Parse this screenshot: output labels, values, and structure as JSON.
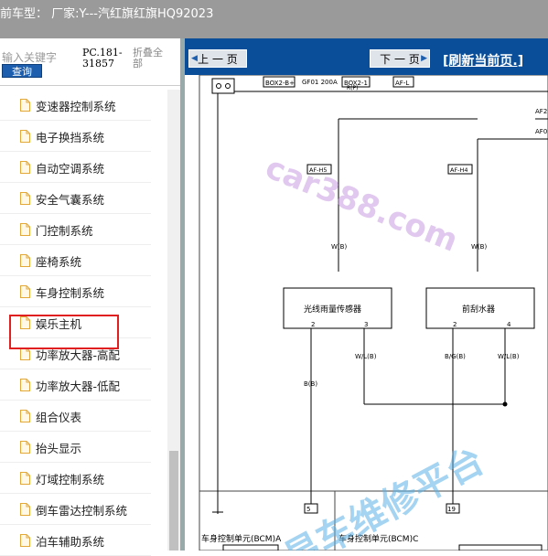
{
  "titlebar": {
    "text": "前车型：  厂家:Y---汽红旗红旗HQ92023"
  },
  "left_panel": {
    "keyword_placeholder": "输入关键字",
    "query_button": "查询",
    "pc_code_line1": "PC.181-",
    "pc_code_line2": "31857",
    "collapse_all_line1": "折叠全",
    "collapse_all_line2": "部"
  },
  "tree": {
    "items": [
      {
        "label": "变速器控制系统"
      },
      {
        "label": "电子换挡系统"
      },
      {
        "label": "自动空调系统"
      },
      {
        "label": "安全气囊系统"
      },
      {
        "label": "门控制系统"
      },
      {
        "label": "座椅系统"
      },
      {
        "label": "车身控制系统"
      },
      {
        "label": "娱乐主机"
      },
      {
        "label": "功率放大器-高配"
      },
      {
        "label": "功率放大器-低配"
      },
      {
        "label": "组合仪表"
      },
      {
        "label": "抬头显示"
      },
      {
        "label": "灯域控制系统"
      },
      {
        "label": "倒车雷达控制系统"
      },
      {
        "label": "泊车辅助系统"
      }
    ]
  },
  "nav": {
    "prev": "上 一 页",
    "next": "下 一 页",
    "refresh": "[刷新当前页.]"
  },
  "diagram": {
    "labels": {
      "box2b": "BOX2-B+",
      "gf01": "GF01 200A",
      "box21": "BOX2-1",
      "afl": "AF-L",
      "rp": "R(P)",
      "af2": "AF2",
      "af0": "AF0",
      "afh5": "AF-H5",
      "afh4": "AF-H4",
      "wb1": "W(B)",
      "wb2": "W(B)",
      "light_sensor": "光线雨量传感器",
      "wiper": "前刮水器",
      "p2": "2",
      "p3": "3",
      "p2b": "2",
      "p4": "4",
      "bb": "B(B)",
      "wlb1": "W/L(B)",
      "bgb": "B/G(B)",
      "wlb2": "W/L(B)",
      "bcm_a": "车身控制单元(BCM)A",
      "bcm_c": "车身控制单元(BCM)C",
      "c5": "5",
      "c19": "19"
    },
    "watermarks": {
      "car388": "car388.com",
      "platform": "易车维修平台"
    }
  }
}
